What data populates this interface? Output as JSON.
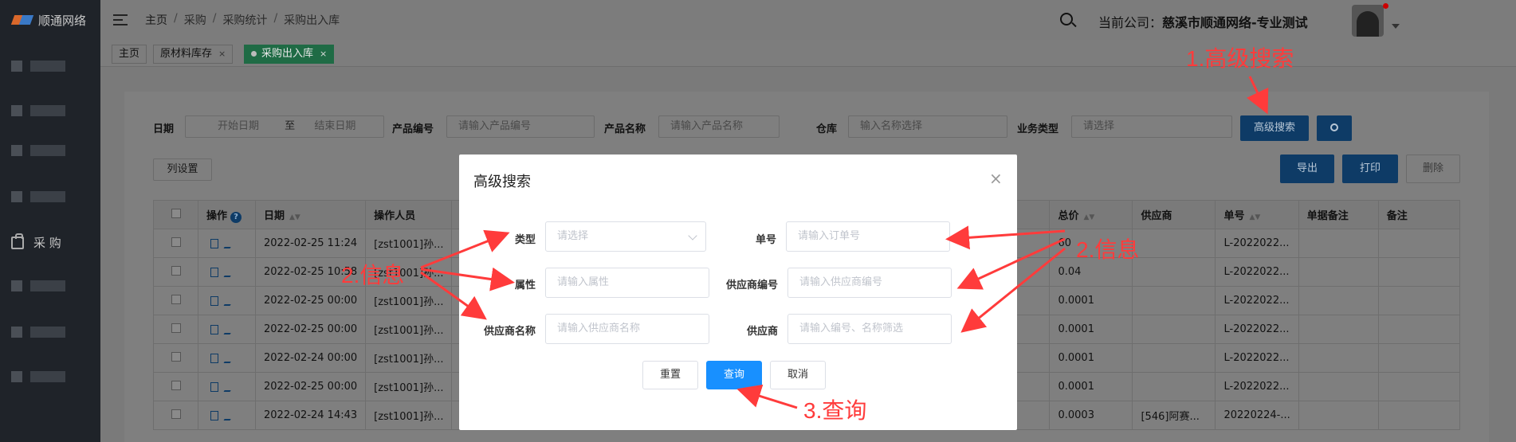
{
  "app": {
    "logo_text": "顺通网络"
  },
  "sidebar": {
    "purchase_label": "采 购"
  },
  "breadcrumb": {
    "home": "主页",
    "purchase": "采购",
    "stats": "采购统计",
    "current": "采购出入库"
  },
  "header": {
    "company_prefix": "当前公司：",
    "company_name": "慈溪市顺通网络-专业测试"
  },
  "tabs": [
    {
      "label": "主页"
    },
    {
      "label": "原材料库存",
      "close": "×"
    },
    {
      "label": "采购出入库",
      "close": "×"
    }
  ],
  "filters": {
    "date_label": "日期",
    "start_placeholder": "开始日期",
    "range_sep": "至",
    "end_placeholder": "结束日期",
    "product_code_label": "产品编号",
    "product_code_placeholder": "请输入产品编号",
    "product_name_label": "产品名称",
    "product_name_placeholder": "请输入产品名称",
    "warehouse_label": "仓库",
    "warehouse_placeholder": "输入名称选择",
    "biz_type_label": "业务类型",
    "biz_type_placeholder": "请选择",
    "advanced_button": "高级搜索"
  },
  "toolbar": {
    "columns": "列设置",
    "export": "导出",
    "print": "打印",
    "delete": "删除"
  },
  "table": {
    "headers": {
      "op": "操作",
      "date": "日期",
      "operator": "操作人员",
      "total": "总价",
      "supplier": "供应商",
      "order_no": "单号",
      "doc_note": "单据备注",
      "note": "备注"
    },
    "rows": [
      {
        "date": "2022-02-25 11:24",
        "operator": "[zst1001]孙...",
        "total": "60",
        "supplier": "",
        "order_no": "L-2022022..."
      },
      {
        "date": "2022-02-25 10:58",
        "operator": "[zst1001]孙...",
        "total": "0.04",
        "supplier": "",
        "order_no": "L-2022022..."
      },
      {
        "date": "2022-02-25 00:00",
        "operator": "[zst1001]孙...",
        "total": "0.0001",
        "supplier": "",
        "order_no": "L-2022022..."
      },
      {
        "date": "2022-02-25 00:00",
        "operator": "[zst1001]孙...",
        "total": "0.0001",
        "supplier": "",
        "order_no": "L-2022022..."
      },
      {
        "date": "2022-02-24 00:00",
        "operator": "[zst1001]孙...",
        "total": "0.0001",
        "supplier": "",
        "order_no": "L-2022022..."
      },
      {
        "date": "2022-02-25 00:00",
        "operator": "[zst1001]孙...",
        "total": "0.0001",
        "supplier": "",
        "order_no": "L-2022022..."
      },
      {
        "date": "2022-02-24 14:43",
        "operator": "[zst1001]孙...",
        "total": "0.0003",
        "supplier": "[546]阿赛...",
        "order_no": "20220224-..."
      }
    ]
  },
  "modal": {
    "title": "高级搜索",
    "close": "×",
    "type_label": "类型",
    "type_placeholder": "请选择",
    "order_label": "单号",
    "order_placeholder": "请输入订单号",
    "attr_label": "属性",
    "attr_placeholder": "请输入属性",
    "supplier_code_label": "供应商编号",
    "supplier_code_placeholder": "请输入供应商编号",
    "supplier_name_label": "供应商名称",
    "supplier_name_placeholder": "请输入供应商名称",
    "supplier_label": "供应商",
    "supplier_placeholder": "请输入编号、名称筛选",
    "reset": "重置",
    "query": "查询",
    "cancel": "取消"
  },
  "annotations": {
    "step1": "1.高级搜索",
    "step2_left": "2.信息",
    "step2_right": "2.信息",
    "step3": "3.查询"
  },
  "colors": {
    "annotation": "#ff3b3b",
    "primary": "#1890ff",
    "sidebar": "#1f2329"
  }
}
